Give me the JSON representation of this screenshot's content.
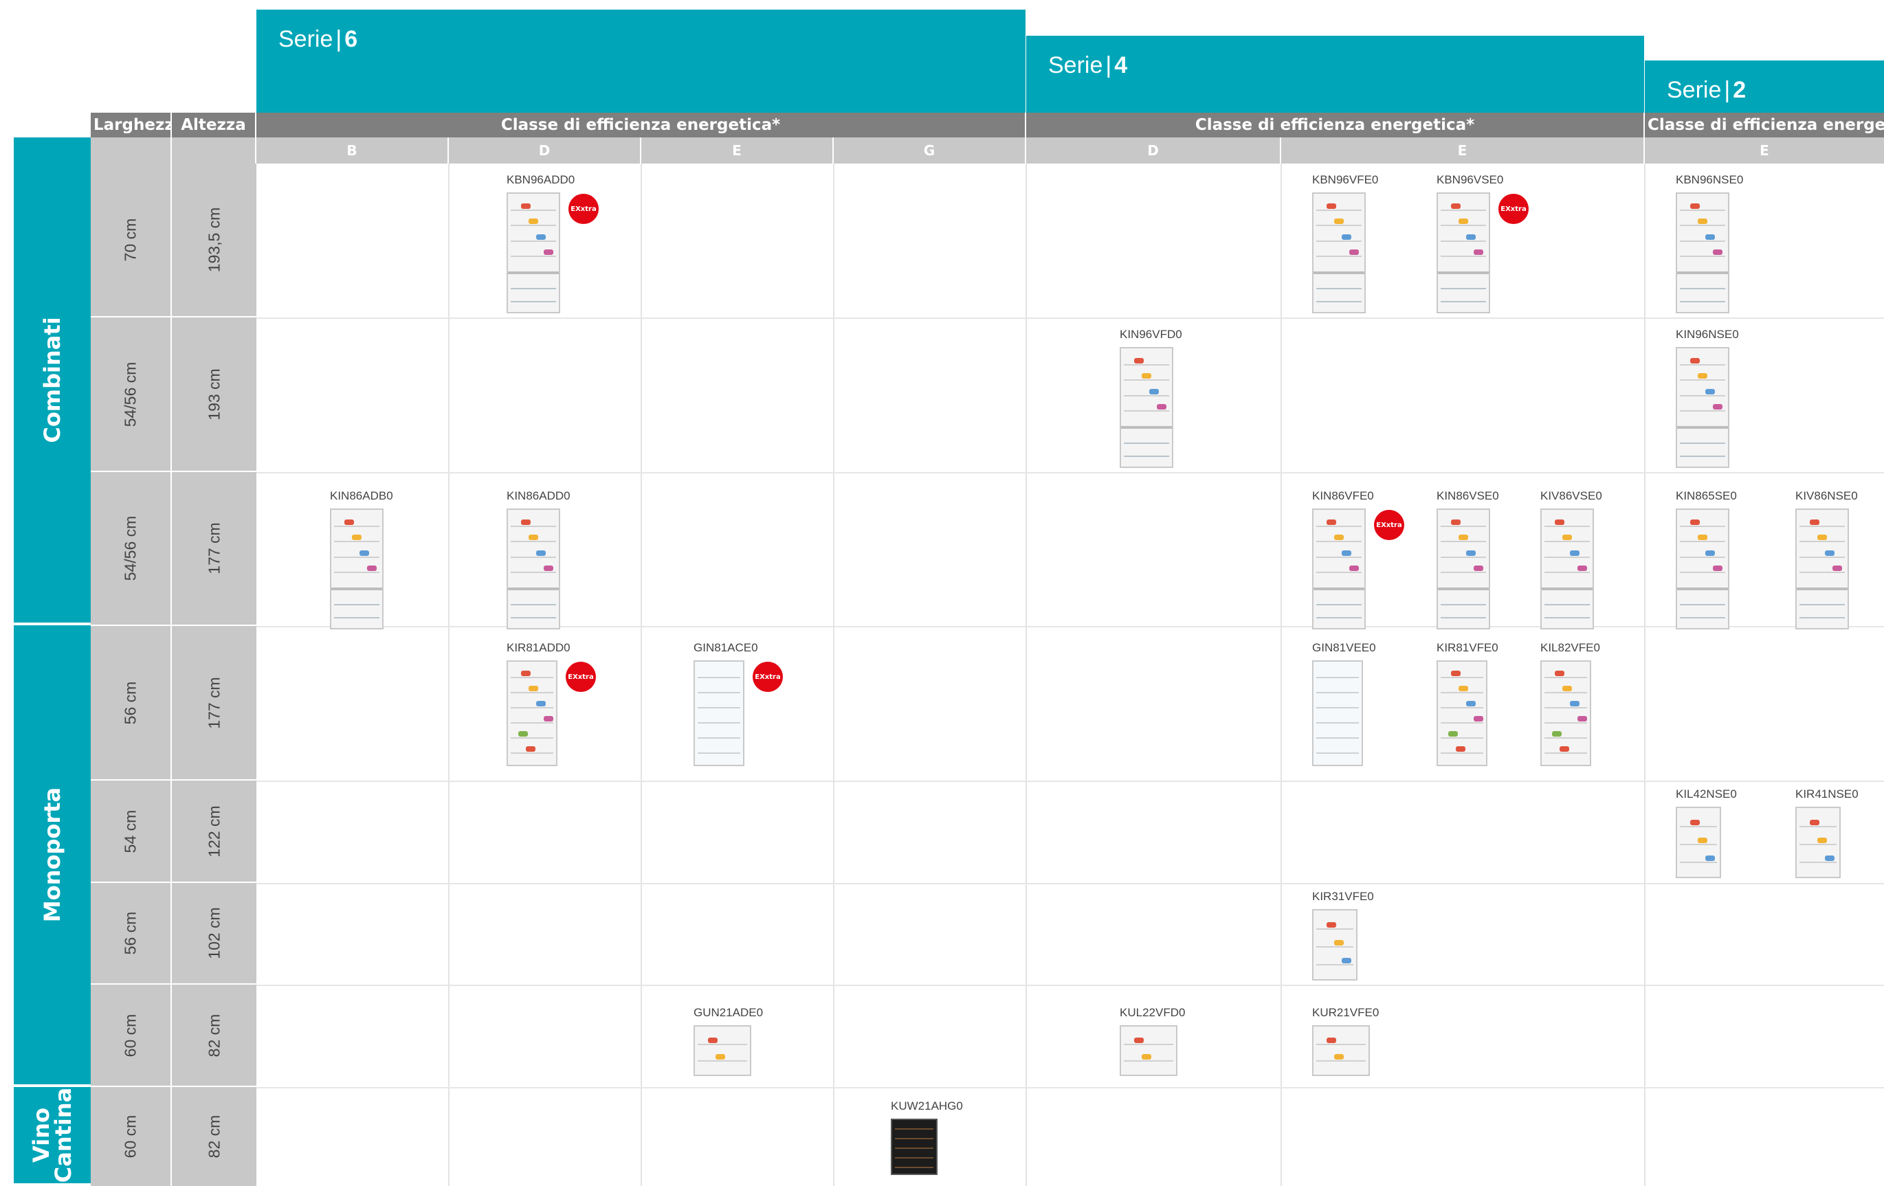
{
  "series": [
    {
      "label": "Serie",
      "num": "6"
    },
    {
      "label": "Serie",
      "num": "4"
    },
    {
      "label": "Serie",
      "num": "2"
    }
  ],
  "headers": {
    "width": "Larghezza",
    "height": "Altezza",
    "energy_class": "Classe di efficienza energetica*"
  },
  "grades": [
    "B",
    "D",
    "E",
    "G",
    "D",
    "E",
    "E"
  ],
  "categories": [
    "Combinati",
    "Monoporta",
    "Vino\nCantina"
  ],
  "rows": [
    {
      "width": "70 cm",
      "height": "193,5 cm"
    },
    {
      "width": "54/56 cm",
      "height": "193 cm"
    },
    {
      "width": "54/56 cm",
      "height": "177 cm"
    },
    {
      "width": "56 cm",
      "height": "177 cm"
    },
    {
      "width": "54 cm",
      "height": "122 cm"
    },
    {
      "width": "56 cm",
      "height": "102 cm"
    },
    {
      "width": "60 cm",
      "height": "82 cm"
    },
    {
      "width": "60 cm",
      "height": "82 cm"
    }
  ],
  "badge_label": "EXxtra",
  "products": [
    {
      "code": "KBN96ADD0",
      "type": "combi",
      "badge": true
    },
    {
      "code": "KBN96VFE0",
      "type": "combi",
      "badge": false
    },
    {
      "code": "KBN96VSE0",
      "type": "combi",
      "badge": true
    },
    {
      "code": "KBN96NSE0",
      "type": "combi",
      "badge": false
    },
    {
      "code": "KIN96VFD0",
      "type": "combi",
      "badge": false
    },
    {
      "code": "KIN96NSE0",
      "type": "combi",
      "badge": false
    },
    {
      "code": "KIN86ADB0",
      "type": "combi",
      "badge": false
    },
    {
      "code": "KIN86ADD0",
      "type": "combi",
      "badge": false
    },
    {
      "code": "KIN86VFE0",
      "type": "combi",
      "badge": true
    },
    {
      "code": "KIN86VSE0",
      "type": "combi",
      "badge": false
    },
    {
      "code": "KIV86VSE0",
      "type": "combi",
      "badge": false
    },
    {
      "code": "KIN865SE0",
      "type": "combi",
      "badge": false
    },
    {
      "code": "KIV86NSE0",
      "type": "combi",
      "badge": false
    },
    {
      "code": "KIR81ADD0",
      "type": "mono",
      "badge": true
    },
    {
      "code": "GIN81ACE0",
      "type": "freezer",
      "badge": true
    },
    {
      "code": "GIN81VEE0",
      "type": "freezer",
      "badge": false
    },
    {
      "code": "KIR81VFE0",
      "type": "mono",
      "badge": false
    },
    {
      "code": "KIL82VFE0",
      "type": "mono",
      "badge": false
    },
    {
      "code": "KIL42NSE0",
      "type": "small",
      "badge": false
    },
    {
      "code": "KIR41NSE0",
      "type": "small",
      "badge": false
    },
    {
      "code": "KIR31VFE0",
      "type": "small",
      "badge": false
    },
    {
      "code": "GUN21ADE0",
      "type": "under",
      "badge": false
    },
    {
      "code": "KUL22VFD0",
      "type": "under",
      "badge": false
    },
    {
      "code": "KUR21VFE0",
      "type": "under",
      "badge": false
    },
    {
      "code": "KUW21AHG0",
      "type": "wine",
      "badge": false
    }
  ]
}
